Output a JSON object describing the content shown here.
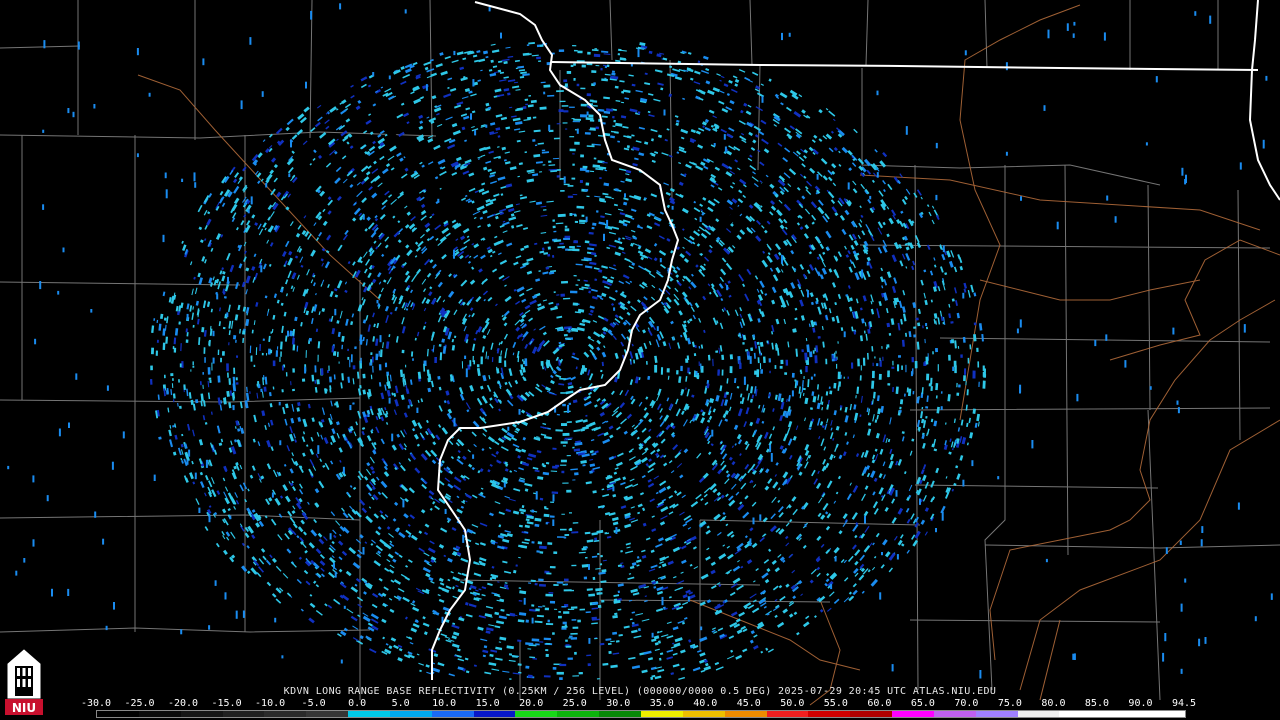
{
  "radar": {
    "product_caption": "KDVN LONG RANGE BASE REFLECTIVITY (0.25KM / 256 LEVEL) (000000/0000 0.5 DEG) 2025-07-29 20:45 UTC  ATLAS.NIU.EDU",
    "scale_labels": [
      "-30.0",
      "-25.0",
      "-20.0",
      "-15.0",
      "-10.0",
      "-5.0",
      "0.0",
      "5.0",
      "10.0",
      "15.0",
      "20.0",
      "25.0",
      "30.0",
      "35.0",
      "40.0",
      "45.0",
      "50.0",
      "55.0",
      "60.0",
      "65.0",
      "70.0",
      "75.0",
      "80.0",
      "85.0",
      "90.0",
      "94.5"
    ],
    "scale_colors": [
      "#000000",
      "#0a0a0a",
      "#151515",
      "#202020",
      "#2a2a2a",
      "#353535",
      "#00c8e6",
      "#00a8f0",
      "#1a6af5",
      "#0818c8",
      "#18d818",
      "#0cb40c",
      "#088808",
      "#f0f000",
      "#f0c000",
      "#f08c00",
      "#f02020",
      "#d00000",
      "#b00000",
      "#ff00ff",
      "#c060f0",
      "#a080ff",
      "#f0f0f0",
      "#ffffff",
      "#ffffff",
      "#ffffff"
    ],
    "logo_text": "NIU"
  },
  "colors": {
    "background": "#000000",
    "county_lines": "#8a8a8a",
    "rivers_roads": "#b06a3a",
    "state_lines": "#ffffff",
    "echo_light": "#2ec8e8",
    "echo_medium": "#1a8cf0",
    "echo_dark": "#1030c0"
  }
}
